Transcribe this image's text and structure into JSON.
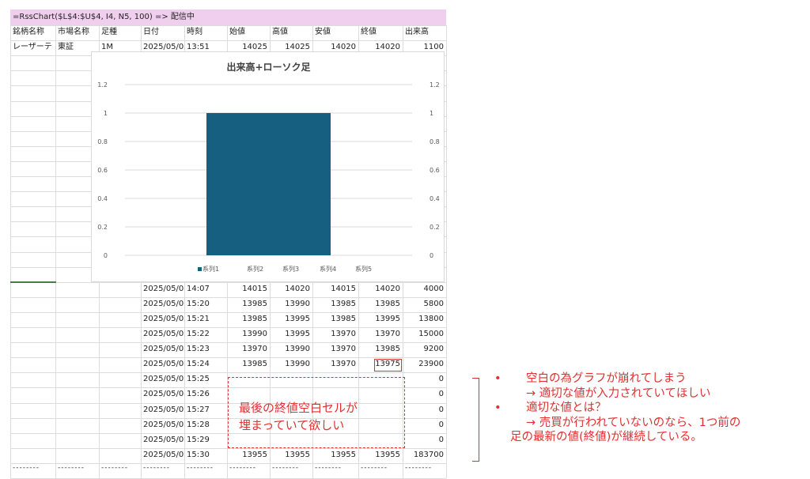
{
  "formula": "=RssChart($L$4:$U$4, I4, N5, 100) => 配信中",
  "headers": [
    "銘柄名称",
    "市場名称",
    "足種",
    "日付",
    "時刻",
    "始値",
    "高値",
    "安値",
    "終値",
    "出来高"
  ],
  "first_row": [
    "レーザーテ",
    "東証",
    "1M",
    "2025/05/0",
    "13:51",
    "14025",
    "14025",
    "14020",
    "14020",
    "1100"
  ],
  "rows": [
    [
      "2025/05/0",
      "14:07",
      "14015",
      "14020",
      "14015",
      "14020",
      "4000"
    ],
    [
      "2025/05/0",
      "15:20",
      "13985",
      "13990",
      "13985",
      "13985",
      "5800"
    ],
    [
      "2025/05/0",
      "15:21",
      "13985",
      "13995",
      "13985",
      "13995",
      "13800"
    ],
    [
      "2025/05/0",
      "15:22",
      "13990",
      "13995",
      "13970",
      "13970",
      "15000"
    ],
    [
      "2025/05/0",
      "15:23",
      "13970",
      "13990",
      "13970",
      "13985",
      "9200"
    ],
    [
      "2025/05/0",
      "15:24",
      "13985",
      "13990",
      "13970",
      "13975",
      "23900"
    ],
    [
      "2025/05/0",
      "15:25",
      "",
      "",
      "",
      "",
      "0"
    ],
    [
      "2025/05/0",
      "15:26",
      "",
      "",
      "",
      "",
      "0"
    ],
    [
      "2025/05/0",
      "15:27",
      "",
      "",
      "",
      "",
      "0"
    ],
    [
      "2025/05/0",
      "15:28",
      "",
      "",
      "",
      "",
      "0"
    ],
    [
      "2025/05/0",
      "15:29",
      "",
      "",
      "",
      "",
      "0"
    ],
    [
      "2025/05/0",
      "15:30",
      "13955",
      "13955",
      "13955",
      "13955",
      "183700"
    ]
  ],
  "dashes": "--------",
  "chart_data": {
    "type": "bar",
    "title": "出来高+ローソク足",
    "categories": [
      ""
    ],
    "series": [
      {
        "name": "系列1",
        "values": [
          1
        ],
        "color": "#175f80"
      },
      {
        "name": "系列2",
        "values": [
          0
        ]
      },
      {
        "name": "系列3",
        "values": [
          0
        ]
      },
      {
        "name": "系列4",
        "values": [
          0
        ]
      },
      {
        "name": "系列5",
        "values": [
          0
        ]
      }
    ],
    "ylim": [
      0,
      1.2
    ],
    "yticks": [
      "0",
      "0.2",
      "0.4",
      "0.6",
      "0.8",
      "1",
      "1.2"
    ],
    "secondary_axis": true,
    "grid": true,
    "legend": "bottom"
  },
  "annotation": {
    "box_text": [
      "最後の終値空白セルが",
      "埋まっていて欲しい"
    ],
    "comments": [
      {
        "bullet": "•",
        "text": "空白の為グラフが崩れてしまう"
      },
      {
        "bullet": "",
        "text": "→ 適切な値が入力されていてほしい"
      },
      {
        "bullet": "•",
        "text": "適切な値とは？"
      },
      {
        "bullet": "",
        "text": "→ 売買が行われていないのなら、1つ前の"
      },
      {
        "bullet": "",
        "text": "足の最新の値(終値)が継続している。"
      }
    ]
  }
}
